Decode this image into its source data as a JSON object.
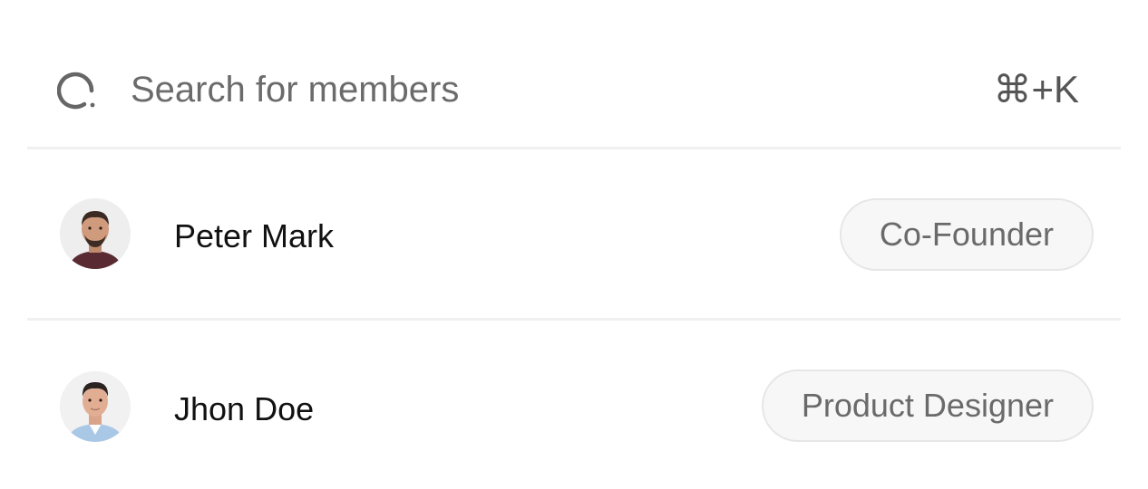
{
  "search": {
    "placeholder": "Search for members",
    "value": "",
    "icon": "search-icon",
    "shortcut": "⌘+K"
  },
  "members": [
    {
      "name": "Peter Mark",
      "role": "Co-Founder",
      "avatar": "avatar-peter-mark"
    },
    {
      "name": "Jhon Doe",
      "role": "Product Designer",
      "avatar": "avatar-jhon-doe"
    }
  ],
  "colors": {
    "text_primary": "#111111",
    "text_muted": "#6b6b6b",
    "badge_bg": "#f7f7f7",
    "badge_border": "#e6e6e6",
    "divider": "#f0f0f0"
  }
}
